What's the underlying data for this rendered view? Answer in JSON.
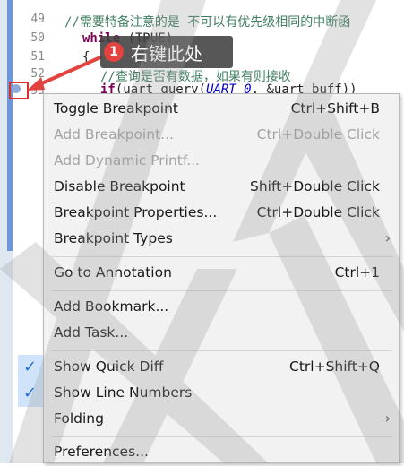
{
  "editor": {
    "line_numbers": [
      "49",
      "50",
      "51",
      "52",
      "53"
    ],
    "code_lines": [
      {
        "parts": [
          {
            "cls": "code-comment",
            "text": "//需要特备注意的是 不可以有优先级相同的中断函"
          }
        ]
      },
      {
        "parts": [
          {
            "cls": "code-kw",
            "text": "while"
          },
          {
            "cls": "code-plain",
            "text": " (TRUE)"
          }
        ]
      },
      {
        "parts": [
          {
            "cls": "code-plain",
            "text": "{"
          }
        ]
      },
      {
        "parts": [
          {
            "cls": "code-comment",
            "text": "  //查询是否有数据，如果有则接收"
          }
        ]
      },
      {
        "parts": [
          {
            "cls": "code-kw",
            "text": "  if"
          },
          {
            "cls": "code-plain",
            "text": "(uart_query("
          },
          {
            "cls": "code-italic",
            "text": "UART_0"
          },
          {
            "cls": "code-plain",
            "text": ", &uart_buff))"
          }
        ]
      }
    ]
  },
  "callout": {
    "number": "1",
    "text": "右键此处"
  },
  "menu": {
    "items": [
      {
        "label": "Toggle Breakpoint",
        "shortcut": "Ctrl+Shift+B"
      },
      {
        "label": "Add Breakpoint...",
        "shortcut": "Ctrl+Double Click"
      },
      {
        "label": "Add Dynamic Printf...",
        "shortcut": ""
      },
      {
        "label": "Disable Breakpoint",
        "shortcut": "Shift+Double Click"
      },
      {
        "label": "Breakpoint Properties...",
        "shortcut": "Ctrl+Double Click"
      },
      {
        "label": "Breakpoint Types",
        "shortcut": ""
      },
      {
        "label": "Go to Annotation",
        "shortcut": "Ctrl+1"
      },
      {
        "label": "Add Bookmark...",
        "shortcut": ""
      },
      {
        "label": "Add Task...",
        "shortcut": ""
      },
      {
        "label": "Show Quick Diff",
        "shortcut": "Ctrl+Shift+Q"
      },
      {
        "label": "Show Line Numbers",
        "shortcut": ""
      },
      {
        "label": "Folding",
        "shortcut": ""
      },
      {
        "label": "Preferences...",
        "shortcut": ""
      }
    ]
  },
  "colors": {
    "accent_red": "#e2433f",
    "check_blue": "#2a6fd6",
    "disabled_text": "#a3a3a3"
  }
}
